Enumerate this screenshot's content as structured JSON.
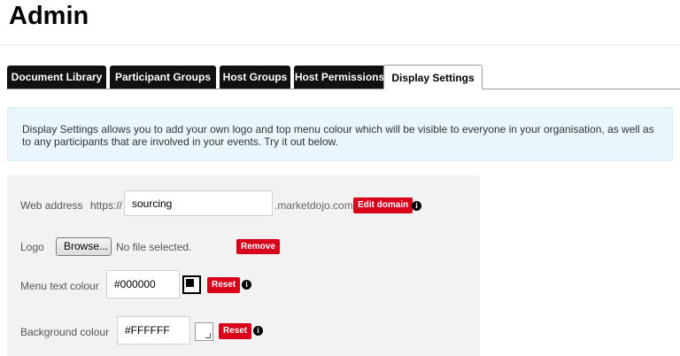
{
  "page": {
    "title": "Admin"
  },
  "tabs": [
    {
      "label": "Document Library",
      "active": false
    },
    {
      "label": "Participant Groups",
      "active": false
    },
    {
      "label": "Host Groups",
      "active": false
    },
    {
      "label": "Host Permissions",
      "active": false
    },
    {
      "label": "Display Settings",
      "active": true
    }
  ],
  "info": {
    "text": "Display Settings allows you to add your own logo and top menu colour which will be visible to everyone in your organisation, as well as to any participants that are involved in your events. Try it out below."
  },
  "settings": {
    "web_address": {
      "label": "Web address",
      "prefix": "https://",
      "value": "sourcing",
      "suffix": ".marketdojo.com",
      "button": "Edit domain"
    },
    "logo": {
      "label": "Logo",
      "browse": "Browse...",
      "status": "No file selected.",
      "button": "Remove"
    },
    "menu_text_colour": {
      "label": "Menu text colour",
      "value": "#000000",
      "button": "Reset",
      "swatch_color": "#000000"
    },
    "background_colour": {
      "label": "Background colour",
      "value": "#FFFFFF",
      "button": "Reset",
      "swatch_color": "#FFFFFF"
    }
  },
  "colors": {
    "accent_red": "#d9001b",
    "tab_dark": "#111111",
    "info_bg": "#eaf6fb"
  },
  "icons": {
    "info": "info-icon"
  }
}
